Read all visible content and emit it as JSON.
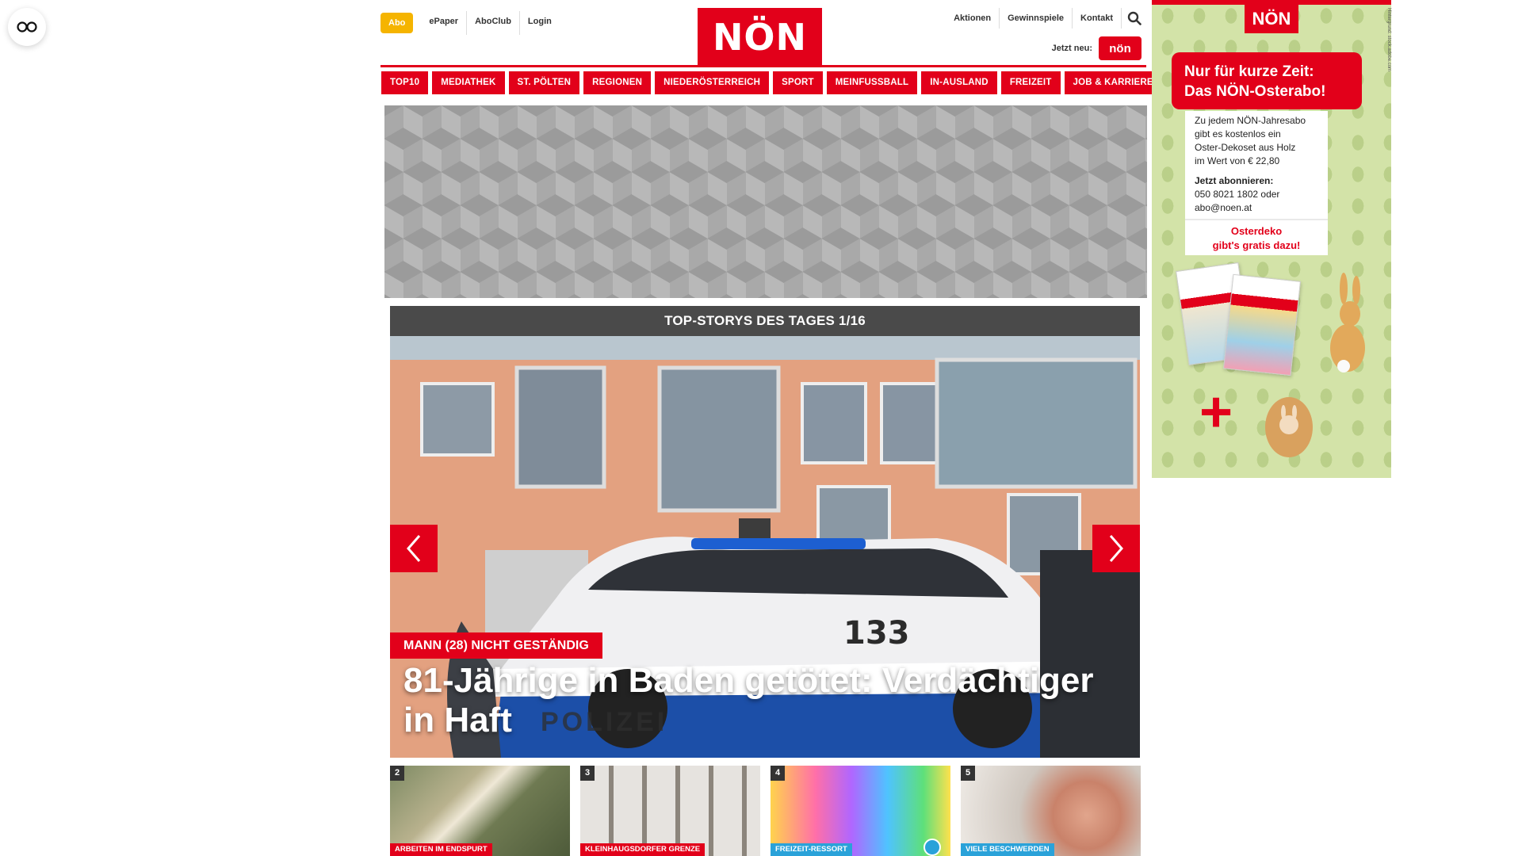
{
  "header": {
    "abo": "Abo",
    "left_links": [
      "ePaper",
      "AboClub",
      "Login"
    ],
    "logo": "NÖN",
    "right_links": [
      "Aktionen",
      "Gewinnspiele",
      "Kontakt"
    ],
    "jetzt_neu": "Jetzt neu:",
    "mini_logo": "nön"
  },
  "mainnav": [
    "TOP10",
    "MEDIATHEK",
    "ST. PÖLTEN",
    "REGIONEN",
    "NIEDERÖSTERREICH",
    "SPORT",
    "MEINFUSSBALL",
    "IN-AUSLAND",
    "FREIZEIT",
    "JOB & KARRIERE"
  ],
  "stories": {
    "header": "TOP-STORYS DES TAGES 1/16",
    "kicker": "MANN (28) NICHT GESTÄNDIG",
    "headline": "81-Jährige in Baden getötet: Verdächtiger in Haft",
    "car_number": "133",
    "car_text": "POLIZEI"
  },
  "thumbs": [
    {
      "num": "2",
      "cat": "ARBEITEN IM ENDSPURT",
      "color": "#e2001a"
    },
    {
      "num": "3",
      "cat": "KLEINHAUGSDORFER GRENZE",
      "color": "#e2001a"
    },
    {
      "num": "4",
      "cat": "FREIZEIT-RESSORT",
      "color": "#2aa2d9"
    },
    {
      "num": "5",
      "cat": "VIELE BESCHWERDEN",
      "color": "#2aa2d9"
    }
  ],
  "side_ad": {
    "logo": "NÖN",
    "tag": "Hintergrund: stock.adobe.com",
    "promo_line1": "Nur für kurze Zeit:",
    "promo_line2": "Das NÖN-Osterabo!",
    "body": [
      "Zu jedem NÖN-Jahresabo",
      "gibt es kostenlos ein",
      "Oster-Dekoset aus Holz",
      "im Wert von € 22,80"
    ],
    "sub_title": "Jetzt abonnieren:",
    "sub_lines": [
      "050 8021 1802 oder",
      "abo@noen.at"
    ],
    "deko_line1": "Osterdeko",
    "deko_line2": "gibt's gratis dazu!",
    "plus": "+"
  },
  "colors": {
    "brand": "#e2001a",
    "abo": "#f5b400",
    "accent_blue": "#2aa2d9"
  }
}
